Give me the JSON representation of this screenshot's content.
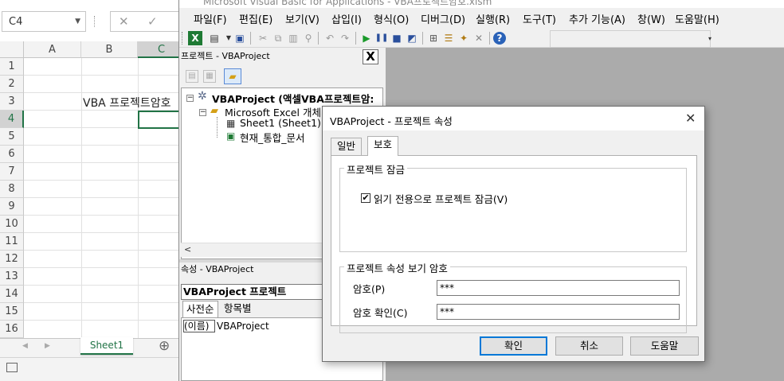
{
  "excel": {
    "namebox": "C4",
    "fx_cancel": "✕",
    "fx_enter": "✓",
    "columns": [
      "A",
      "B",
      "C"
    ],
    "rows": [
      "1",
      "2",
      "3",
      "4",
      "5",
      "6",
      "7",
      "8",
      "9",
      "10",
      "11",
      "12",
      "13",
      "14",
      "15",
      "16"
    ],
    "cell_b3": "VBA 프로젝트암호",
    "sheet_tab": "Sheet1",
    "add_sheet": "⊕"
  },
  "vbe": {
    "title": "Microsoft Visual Basic for Applications - VBA프로젝트암호.xlsm",
    "menu": [
      "파일(F)",
      "편집(E)",
      "보기(V)",
      "삽입(I)",
      "형식(O)",
      "디버그(D)",
      "실행(R)",
      "도구(T)",
      "추가 기능(A)",
      "창(W)",
      "도움말(H)"
    ],
    "project_explorer": {
      "title": "프로젝트 - VBAProject",
      "close": "X",
      "root": "VBAProject (액셀VBA프로젝트암:",
      "folder": "Microsoft Excel 개체",
      "items": [
        "Sheet1 (Sheet1)",
        "현재_통합_문서"
      ]
    },
    "properties": {
      "title": "속성 - VBAProject",
      "combo": "VBAProject  프로젝트",
      "tabs": [
        "사전순",
        "항목별"
      ],
      "row_name": "(이름)",
      "row_value": "VBAProject"
    }
  },
  "dialog": {
    "title": "VBAProject - 프로젝트 속성",
    "close": "✕",
    "tabs": [
      "일반",
      "보호"
    ],
    "lock_group": "프로젝트 잠금",
    "lock_checkbox": "읽기 전용으로 프로젝트 잠금(V)",
    "lock_checked": true,
    "password_group": "프로젝트 속성 보기 암호",
    "password_label": "암호(P)",
    "password_value": "***",
    "confirm_label": "암호 확인(C)",
    "confirm_value": "***",
    "ok": "확인",
    "cancel": "취소",
    "help": "도움말"
  },
  "colors": {
    "excel_green": "#217346",
    "focus_blue": "#0078d7",
    "mdi_gray": "#ababab"
  }
}
